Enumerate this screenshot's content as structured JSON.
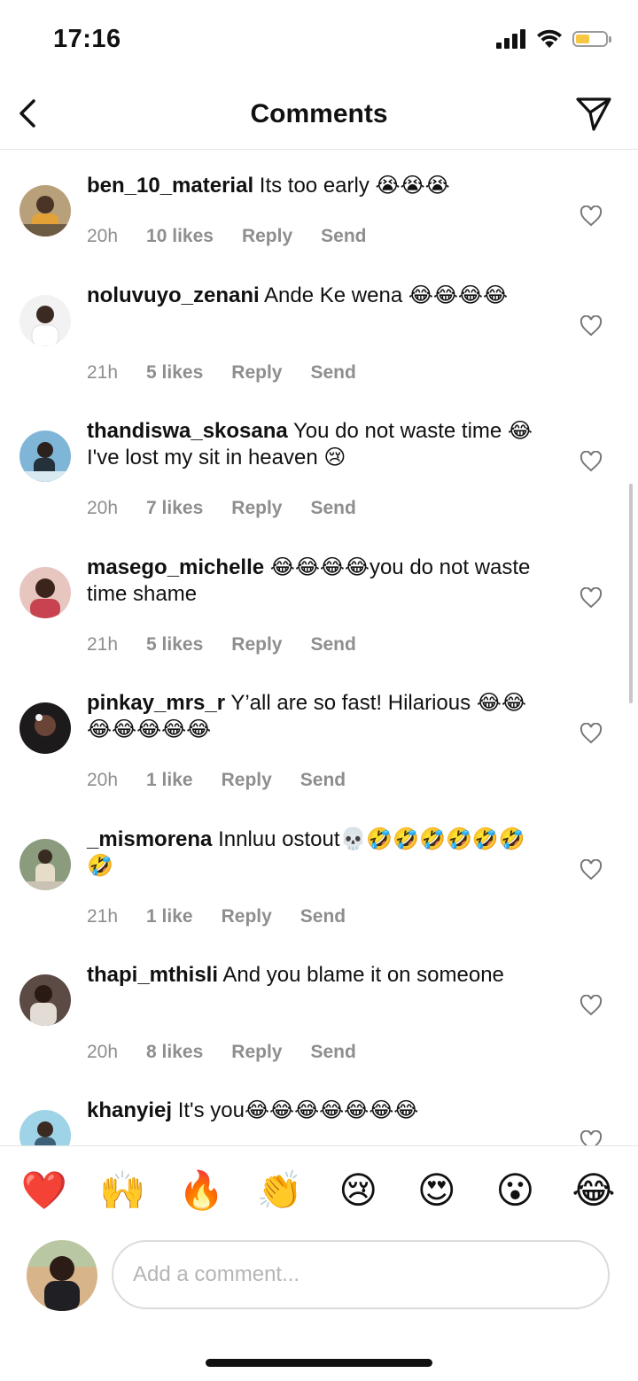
{
  "status_bar": {
    "time": "17:16"
  },
  "header": {
    "title": "Comments"
  },
  "comments": [
    {
      "username": "ben_10_material",
      "text": "Its too early 😭😭😭",
      "time": "20h",
      "likes": "10 likes",
      "reply": "Reply",
      "send": "Send"
    },
    {
      "username": "noluvuyo_zenani",
      "text": "Ande Ke wena 😂😂😂😂",
      "time": "21h",
      "likes": "5 likes",
      "reply": "Reply",
      "send": "Send"
    },
    {
      "username": "thandiswa_skosana",
      "text": "You do not waste time 😂 I've lost my sit in heaven 😢",
      "time": "20h",
      "likes": "7 likes",
      "reply": "Reply",
      "send": "Send"
    },
    {
      "username": "masego_michelle",
      "text": "😂😂😂😂you do not waste time shame",
      "time": "21h",
      "likes": "5 likes",
      "reply": "Reply",
      "send": "Send"
    },
    {
      "username": "pinkay_mrs_r",
      "text": "Y’all are so fast! Hilarious 😂😂😂😂😂😂😂",
      "time": "20h",
      "likes": "1 like",
      "reply": "Reply",
      "send": "Send"
    },
    {
      "username": "_mismorena",
      "text": "Innluu ostout💀🤣🤣🤣🤣🤣🤣🤣",
      "time": "21h",
      "likes": "1 like",
      "reply": "Reply",
      "send": "Send"
    },
    {
      "username": "thapi_mthisli",
      "text": "And you blame it on someone",
      "time": "20h",
      "likes": "8 likes",
      "reply": "Reply",
      "send": "Send"
    },
    {
      "username": "khanyiej",
      "text": "It's you😂😂😂😂😂😂😂",
      "time": "",
      "likes": "",
      "reply": "",
      "send": ""
    }
  ],
  "reactions": [
    "❤️",
    "🙌",
    "🔥",
    "👏",
    "😢",
    "😍",
    "😮",
    "😂"
  ],
  "composer": {
    "placeholder": "Add a comment..."
  },
  "colors": {
    "meta_text": "#8e8e8e",
    "battery": "#f7c744"
  }
}
